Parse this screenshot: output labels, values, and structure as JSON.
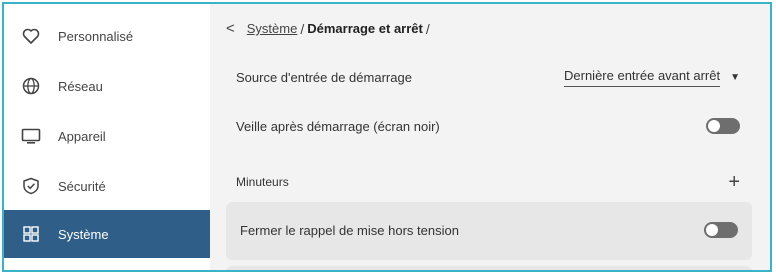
{
  "sidebar": {
    "items": [
      {
        "label": "Personnalisé",
        "icon": "heart-icon"
      },
      {
        "label": "Réseau",
        "icon": "globe-icon"
      },
      {
        "label": "Appareil",
        "icon": "monitor-icon"
      },
      {
        "label": "Sécurité",
        "icon": "shield-check-icon"
      },
      {
        "label": "Système",
        "icon": "grid-icon",
        "active": true
      }
    ]
  },
  "breadcrumb": {
    "back": "<",
    "parent": "Système",
    "separator": "/",
    "current": "Démarrage et arrêt",
    "trailing": "/"
  },
  "settings": {
    "boot_source": {
      "label": "Source d'entrée de démarrage",
      "value": "Dernière entrée avant arrêt"
    },
    "standby": {
      "label": "Veille après démarrage (écran noir)",
      "enabled": false
    },
    "timers": {
      "label": "Minuteurs",
      "add": "+"
    },
    "shutdown_reminder": {
      "label": "Fermer le rappel de mise hors tension",
      "enabled": false
    }
  },
  "colors": {
    "accent": "#2f5f88",
    "frame": "#39b3c9",
    "toggle_off": "#6e6e6e"
  }
}
